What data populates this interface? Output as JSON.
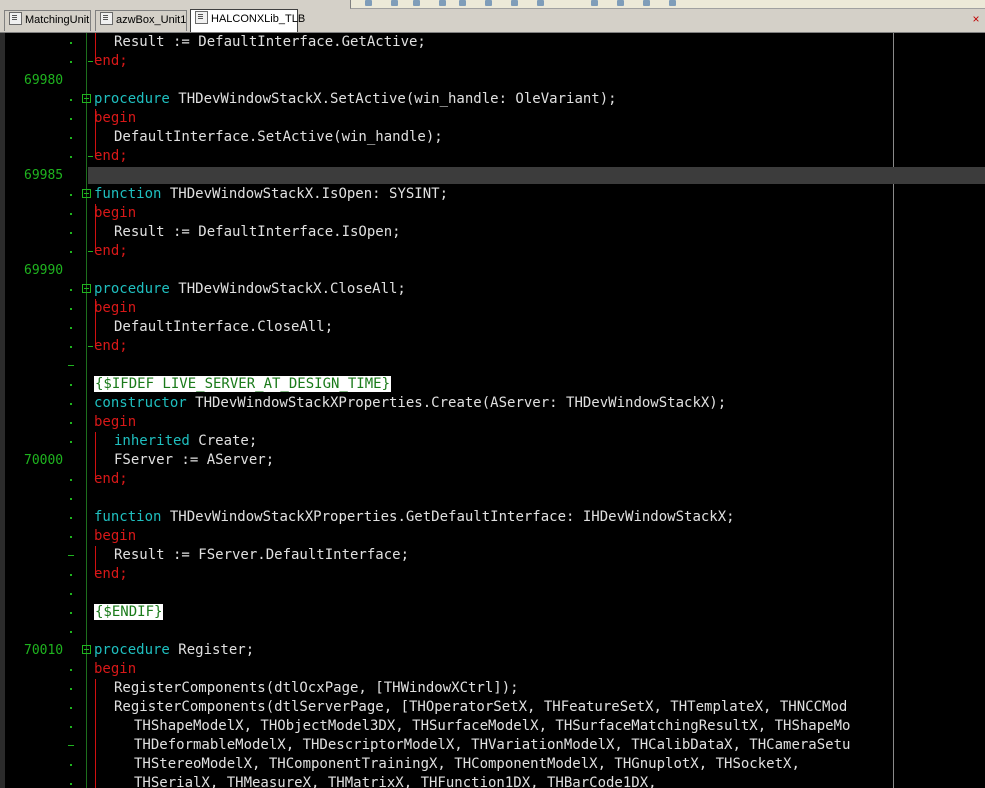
{
  "tabs": [
    {
      "label": "MatchingUnit",
      "active": false
    },
    {
      "label": "azwBox_Unit1",
      "active": false
    },
    {
      "label": "HALCONXLib_TLB",
      "active": true
    }
  ],
  "close_label": "×",
  "editor": {
    "line_numbers": {
      "l69980": "69980",
      "l69985": "69985",
      "l69990": "69990",
      "l70000": "70000",
      "l70010": "70010"
    },
    "code": {
      "c01": "Result := DefaultInterface.GetActive;",
      "c02": "end;",
      "c04a": "procedure",
      "c04b": " THDevWindowStackX.SetActive(win_handle: OleVariant);",
      "c05": "begin",
      "c06": "DefaultInterface.SetActive(win_handle);",
      "c07": "end;",
      "c09a": "function",
      "c09b": " THDevWindowStackX.IsOpen: SYSINT;",
      "c10": "begin",
      "c11": "Result := DefaultInterface.IsOpen;",
      "c12": "end;",
      "c14a": "procedure",
      "c14b": " THDevWindowStackX.CloseAll;",
      "c15": "begin",
      "c16": "DefaultInterface.CloseAll;",
      "c17": "end;",
      "c19": "{$IFDEF LIVE_SERVER_AT_DESIGN_TIME}",
      "c20a": "constructor",
      "c20b": " THDevWindowStackXProperties.Create(AServer: THDevWindowStackX);",
      "c21": "begin",
      "c22a": "inherited",
      "c22b": " Create;",
      "c23": "FServer := AServer;",
      "c24": "end;",
      "c26a": "function",
      "c26b": " THDevWindowStackXProperties.GetDefaultInterface: IHDevWindowStackX;",
      "c27": "begin",
      "c28": "Result := FServer.DefaultInterface;",
      "c29": "end;",
      "c31": "{$ENDIF}",
      "c33a": "procedure",
      "c33b": " Register;",
      "c34": "begin",
      "c35": "RegisterComponents(dtlOcxPage, [THWindowXCtrl]);",
      "c36": "RegisterComponents(dtlServerPage, [THOperatorSetX, THFeatureSetX, THTemplateX, THNCCMod",
      "c37": "THShapeModelX, THObjectModel3DX, THSurfaceModelX, THSurfaceMatchingResultX, THShapeMo",
      "c38": "THDeformableModelX, THDescriptorModelX, THVariationModelX, THCalibDataX, THCameraSetu",
      "c39": "THStereoModelX, THComponentTrainingX, THComponentModelX, THGnuplotX, THSocketX,",
      "c40": "THSerialX, THMeasureX, THMatrixX, THFunction1DX, THBarCode1DX,"
    }
  }
}
